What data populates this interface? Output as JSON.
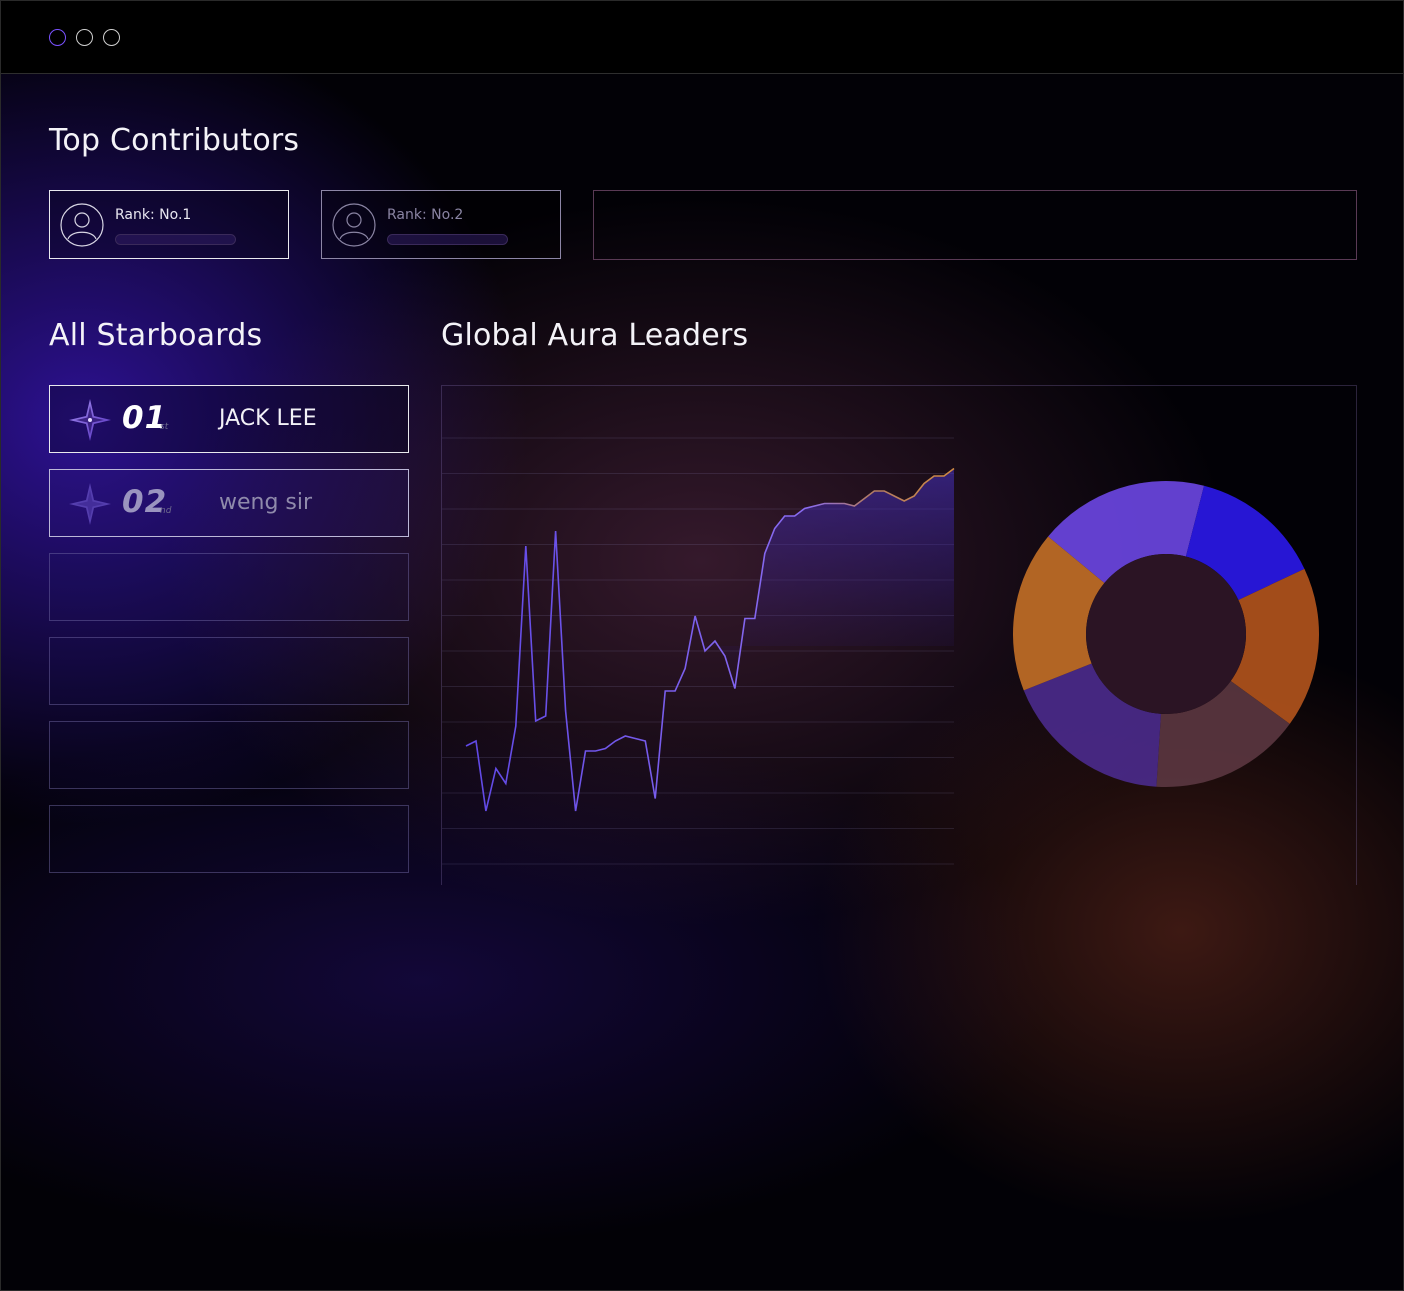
{
  "window": {
    "controls": [
      "close",
      "minimize",
      "maximize"
    ],
    "accent": "#7a52ff"
  },
  "top_contributors": {
    "title": "Top Contributors",
    "cards": [
      {
        "rank_label": "Rank: No.1",
        "icon": "user-avatar-icon"
      },
      {
        "rank_label": "Rank: No.2",
        "icon": "user-avatar-icon"
      }
    ]
  },
  "starboards": {
    "title": "All Starboards",
    "rows": [
      {
        "number": "01",
        "suffix": "st",
        "name": "JACK LEE",
        "icon": "four-point-star-icon"
      },
      {
        "number": "02",
        "suffix": "nd",
        "name": "weng sir",
        "icon": "four-point-star-icon"
      }
    ],
    "empty_rows": 4
  },
  "aura": {
    "title": "Global Aura Leaders"
  },
  "chart_data": [
    {
      "type": "area",
      "x": [
        1,
        2,
        3,
        4,
        5,
        6,
        7,
        8,
        9,
        10,
        11,
        12,
        13,
        14,
        15,
        16,
        17,
        18,
        19,
        20,
        21,
        22,
        23,
        24,
        25,
        26,
        27,
        28,
        29,
        30,
        31,
        32,
        33,
        34,
        35,
        36,
        37,
        38,
        39,
        40,
        41,
        42,
        43,
        44,
        45,
        46,
        47,
        48,
        49,
        50,
        51,
        52,
        53,
        54,
        55,
        56,
        57,
        58,
        59,
        60,
        61,
        62,
        63,
        64
      ],
      "series": [
        {
          "values": [
            28,
            30,
            2,
            19,
            13,
            36,
            108,
            38,
            40,
            114,
            42,
            2,
            26,
            26,
            27,
            30,
            32,
            31,
            30,
            7,
            50,
            50,
            59,
            80,
            66,
            70,
            64,
            51,
            79,
            79,
            105,
            115,
            120,
            120,
            123,
            124,
            125,
            125,
            125,
            124,
            127,
            130,
            130,
            128,
            126,
            128,
            133,
            136,
            136,
            139
          ],
          "color_start": "#6a4de0",
          "color_end": "#c77a3a"
        }
      ],
      "grid": true,
      "ylim": [
        0,
        150
      ]
    },
    {
      "type": "pie",
      "donut": true,
      "values": [
        18,
        14,
        17,
        16,
        18,
        17
      ],
      "colors": [
        "#6a45e0",
        "#2a18e6",
        "#b0521c",
        "#5a3640",
        "#4a2a8a",
        "#c06e26"
      ]
    }
  ]
}
